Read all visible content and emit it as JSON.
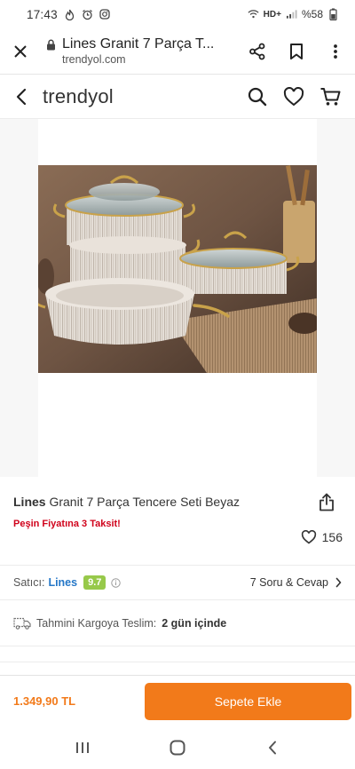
{
  "status": {
    "time": "17:43",
    "network": "HD+",
    "battery": "%58",
    "left_icons": [
      "fire-icon",
      "alarm-icon",
      "instagram-icon"
    ]
  },
  "browser": {
    "title": "Lines Granit 7 Parça T...",
    "url": "trendyol.com"
  },
  "app": {
    "logo": "trendyol"
  },
  "product": {
    "brand": "Lines",
    "name": "Granit 7 Parça Tencere Seti Beyaz",
    "installment": "Peşin Fiyatına 3 Taksit!",
    "favorites": "156"
  },
  "seller": {
    "label": "Satıcı:",
    "name": "Lines",
    "score": "9.7",
    "qa_link": "7 Soru & Cevap"
  },
  "delivery": {
    "label": "Tahmini Kargoya Teslim:",
    "value": "2 gün içinde"
  },
  "cart": {
    "price": "1.349,90 TL",
    "button": "Sepete Ekle"
  },
  "colors": {
    "accent": "#f27a1a",
    "seller_link": "#2577c7",
    "score_badge": "#97c94a",
    "installment": "#d0021b"
  }
}
